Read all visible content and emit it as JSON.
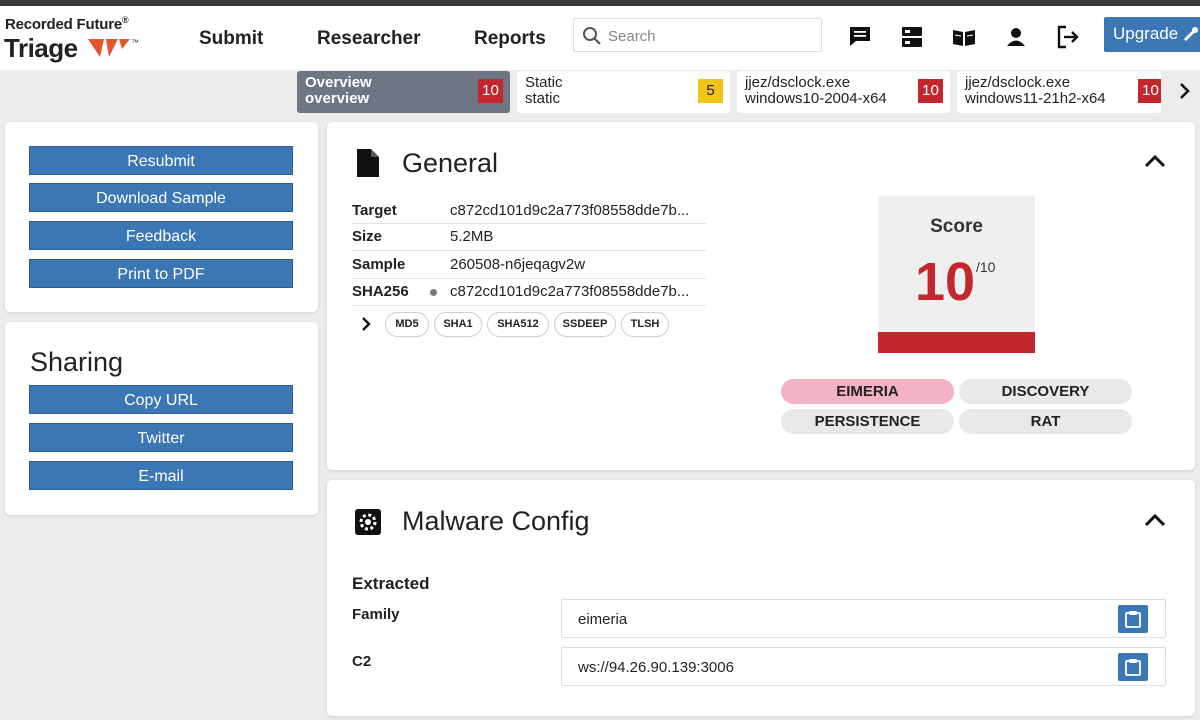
{
  "brand": {
    "line1": "Recorded Future",
    "line1_mark": "®",
    "line2": "Triage",
    "line2_mark": "™",
    "colors": {
      "accent": "#e4572e",
      "primary_button": "#3b76b5",
      "danger": "#c1272d",
      "warning": "#f0c419"
    }
  },
  "nav": {
    "submit": "Submit",
    "researcher": "Researcher",
    "reports": "Reports"
  },
  "search": {
    "placeholder": "Search",
    "value": ""
  },
  "header_icons": [
    "chat-icon",
    "server-icon",
    "book-icon",
    "user-icon",
    "logout-icon"
  ],
  "upgrade_label": "Upgrade",
  "tabs": [
    {
      "line1": "Overview",
      "line2": "overview",
      "score": "10",
      "badge_color": "#c1272d",
      "active": true
    },
    {
      "line1": "Static",
      "line2": "static",
      "score": "5",
      "badge_color": "#f0c419",
      "active": false
    },
    {
      "line1": "jjez/dsclock.exe",
      "line2": "windows10-2004-x64",
      "score": "10",
      "badge_color": "#c1272d",
      "active": false
    },
    {
      "line1": "jjez/dsclock.exe",
      "line2": "windows11-21h2-x64",
      "score": "10",
      "badge_color": "#c1272d",
      "active": false
    }
  ],
  "actions": {
    "resubmit": "Resubmit",
    "download": "Download Sample",
    "feedback": "Feedback",
    "print": "Print to PDF"
  },
  "sharing": {
    "title": "Sharing",
    "copy_url": "Copy URL",
    "twitter": "Twitter",
    "email": "E-mail"
  },
  "general": {
    "title": "General",
    "rows": [
      {
        "label": "Target",
        "value": "c872cd101d9c2a773f08558dde7b..."
      },
      {
        "label": "Size",
        "value": "5.2MB"
      },
      {
        "label": "Sample",
        "value": "260508-n6jeqagv2w"
      },
      {
        "label": "SHA256",
        "value": "c872cd101d9c2a773f08558dde7b..."
      }
    ],
    "hashes": [
      "MD5",
      "SHA1",
      "SHA512",
      "SSDEEP",
      "TLSH"
    ],
    "score": {
      "label": "Score",
      "value": "10",
      "max": "/10",
      "fraction": 1.0
    },
    "tags": [
      "EIMERIA",
      "DISCOVERY",
      "PERSISTENCE",
      "RAT"
    ]
  },
  "malware_config": {
    "title": "Malware Config",
    "subtitle": "Extracted",
    "fields": [
      {
        "label": "Family",
        "value": "eimeria"
      },
      {
        "label": "C2",
        "value": "ws://94.26.90.139:3006"
      }
    ]
  }
}
